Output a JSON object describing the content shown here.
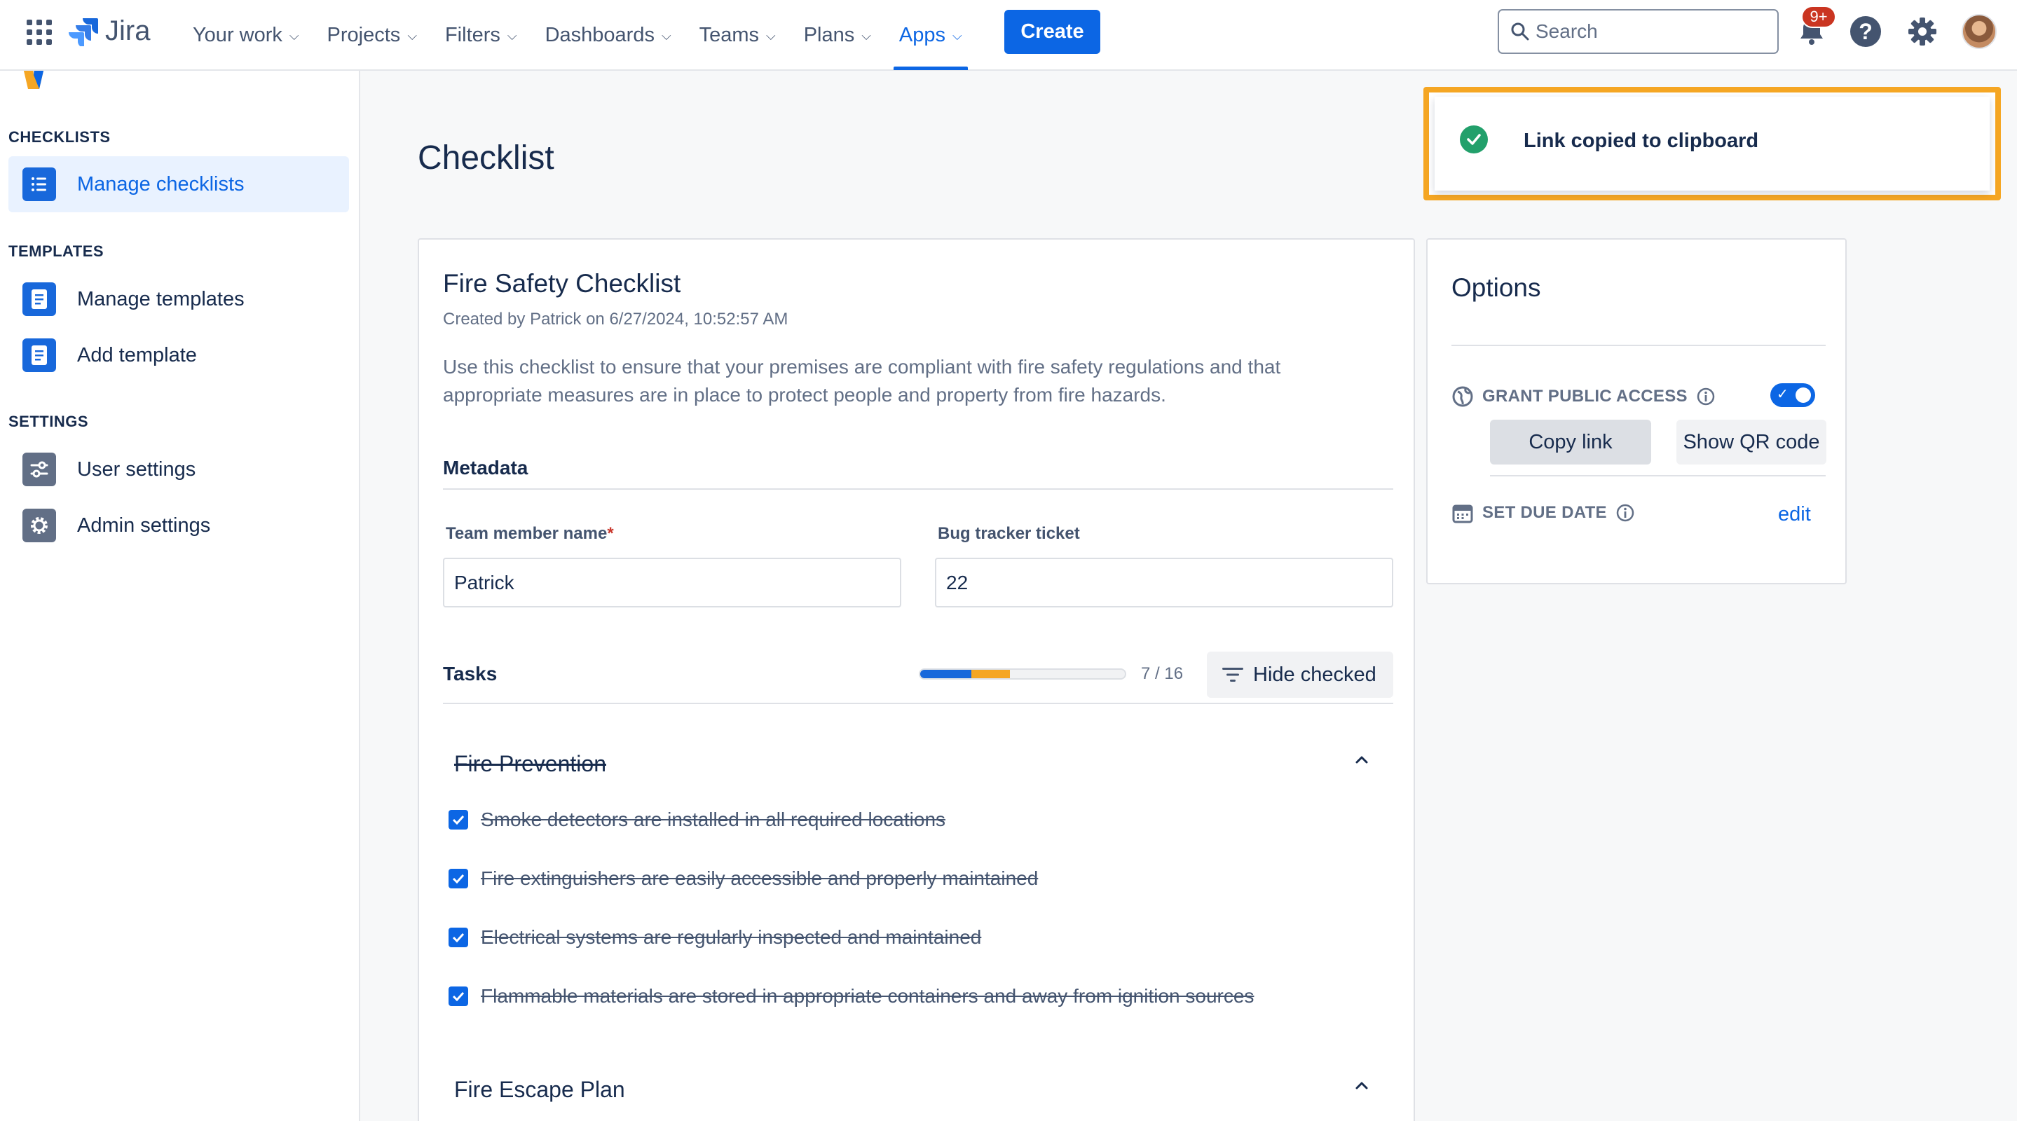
{
  "topnav": {
    "app_name": "Jira",
    "items": [
      {
        "label": "Your work"
      },
      {
        "label": "Projects"
      },
      {
        "label": "Filters"
      },
      {
        "label": "Dashboards"
      },
      {
        "label": "Teams"
      },
      {
        "label": "Plans"
      },
      {
        "label": "Apps",
        "active": true
      }
    ],
    "create_label": "Create",
    "search_placeholder": "Search",
    "notifications_badge": "9+",
    "help_label": "?",
    "colors": {
      "accent": "#0c66e4",
      "badge": "#ca3521"
    }
  },
  "sidebar": {
    "sections": [
      {
        "title": "CHECKLISTS",
        "items": [
          {
            "label": "Manage checklists",
            "selected": true
          }
        ]
      },
      {
        "title": "TEMPLATES",
        "items": [
          {
            "label": "Manage templates"
          },
          {
            "label": "Add template"
          }
        ]
      },
      {
        "title": "SETTINGS",
        "items": [
          {
            "label": "User settings"
          },
          {
            "label": "Admin settings"
          }
        ]
      }
    ]
  },
  "page": {
    "title": "Checklist"
  },
  "checklist": {
    "title": "Fire Safety Checklist",
    "created": "Created by Patrick on 6/27/2024, 10:52:57 AM",
    "description": "Use this checklist to ensure that your premises are compliant with fire safety regulations and that appropriate measures are in place to protect people and property from fire hazards.",
    "metadata_heading": "Metadata",
    "fields": [
      {
        "label": "Team member name",
        "required_mark": "*",
        "value": "Patrick"
      },
      {
        "label": "Bug tracker ticket",
        "value": "22"
      }
    ],
    "tasks_heading": "Tasks",
    "progress": {
      "done_fraction": 0.25,
      "in_review_fraction": 0.19,
      "count_text": "7 / 16",
      "colors": {
        "done": "#1868db",
        "review": "#f5a623"
      }
    },
    "hide_checked_label": "Hide checked",
    "groups": [
      {
        "title": "Fire Prevention",
        "completed": true,
        "tasks": [
          {
            "text": "Smoke detectors are installed in all required locations",
            "checked": true
          },
          {
            "text": "Fire extinguishers are easily accessible and properly maintained",
            "checked": true
          },
          {
            "text": "Electrical systems are regularly inspected and maintained",
            "checked": true
          },
          {
            "text": "Flammable materials are stored in appropriate containers and away from ignition sources",
            "checked": true
          }
        ]
      },
      {
        "title": "Fire Escape Plan",
        "completed": false,
        "tasks": []
      }
    ]
  },
  "options": {
    "title": "Options",
    "public_access_label": "GRANT PUBLIC ACCESS",
    "public_access_enabled": true,
    "copy_link_label": "Copy link",
    "qr_label": "Show QR code",
    "due_date_label": "SET DUE DATE",
    "edit_label": "edit"
  },
  "toast": {
    "message": "Link copied to clipboard",
    "colors": {
      "highlight": "#f5a623",
      "success": "#22a06b"
    }
  }
}
